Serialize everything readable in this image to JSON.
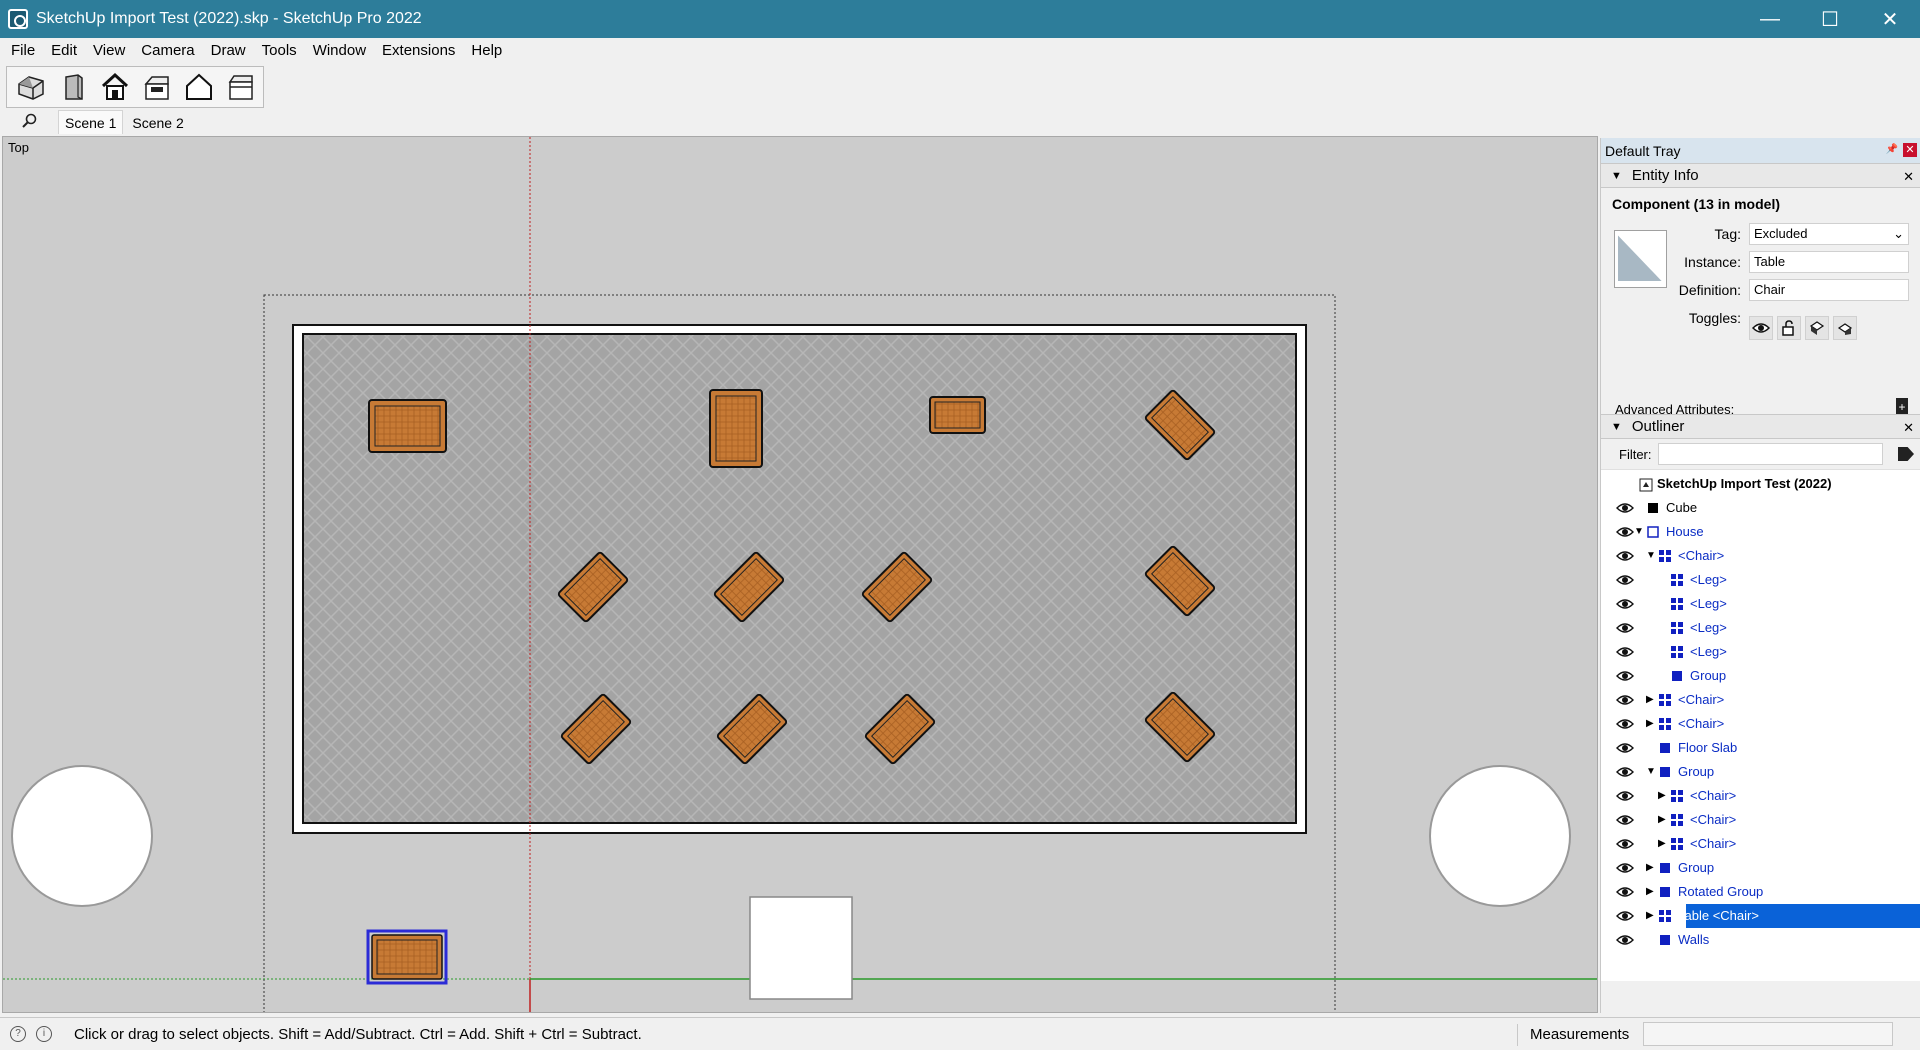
{
  "window": {
    "title": "SketchUp Import Test (2022).skp - SketchUp Pro 2022",
    "minimize": "—",
    "maximize": "☐",
    "close": "✕"
  },
  "menu": [
    "File",
    "Edit",
    "View",
    "Camera",
    "Draw",
    "Tools",
    "Window",
    "Extensions",
    "Help"
  ],
  "toolbar": {
    "tools": [
      "iso-view-icon",
      "front-view-icon",
      "top-view-icon",
      "back-view-icon",
      "left-view-icon",
      "right-view-icon"
    ]
  },
  "scenes": [
    "Scene 1",
    "Scene 2"
  ],
  "viewport": {
    "label": "Top"
  },
  "tray": {
    "title": "Default Tray",
    "entity_info": {
      "header": "Entity Info",
      "title": "Component (13 in model)",
      "tag_label": "Tag:",
      "tag_value": "Excluded",
      "instance_label": "Instance:",
      "instance_value": "Table",
      "definition_label": "Definition:",
      "definition_value": "Chair",
      "toggles_label": "Toggles:",
      "advanced_label": "Advanced Attributes:"
    },
    "outliner": {
      "header": "Outliner",
      "filter_label": "Filter:",
      "filter_value": "",
      "root": "SketchUp Import Test (2022)",
      "items": [
        {
          "label": "Cube",
          "depth": 0,
          "arrow": "",
          "icon": "group-solid",
          "style": "black"
        },
        {
          "label": "House",
          "depth": 0,
          "arrow": "▼",
          "icon": "group-outline",
          "style": "blue"
        },
        {
          "label": "<Chair>",
          "depth": 1,
          "arrow": "▼",
          "icon": "component",
          "style": "blue"
        },
        {
          "label": "<Leg>",
          "depth": 2,
          "arrow": "",
          "icon": "component",
          "style": "blue"
        },
        {
          "label": "<Leg>",
          "depth": 2,
          "arrow": "",
          "icon": "component",
          "style": "blue"
        },
        {
          "label": "<Leg>",
          "depth": 2,
          "arrow": "",
          "icon": "component",
          "style": "blue"
        },
        {
          "label": "<Leg>",
          "depth": 2,
          "arrow": "",
          "icon": "component",
          "style": "blue"
        },
        {
          "label": "Group",
          "depth": 2,
          "arrow": "",
          "icon": "group-solid",
          "style": "blue"
        },
        {
          "label": "<Chair>",
          "depth": 1,
          "arrow": "▶",
          "icon": "component",
          "style": "blue"
        },
        {
          "label": "<Chair>",
          "depth": 1,
          "arrow": "▶",
          "icon": "component",
          "style": "blue"
        },
        {
          "label": "Floor Slab",
          "depth": 1,
          "arrow": "",
          "icon": "group-solid",
          "style": "blue"
        },
        {
          "label": "Group",
          "depth": 1,
          "arrow": "▼",
          "icon": "group-solid",
          "style": "blue"
        },
        {
          "label": "<Chair>",
          "depth": 2,
          "arrow": "▶",
          "icon": "component",
          "style": "blue"
        },
        {
          "label": "<Chair>",
          "depth": 2,
          "arrow": "▶",
          "icon": "component",
          "style": "blue"
        },
        {
          "label": "<Chair>",
          "depth": 2,
          "arrow": "▶",
          "icon": "component",
          "style": "blue"
        },
        {
          "label": "Group",
          "depth": 1,
          "arrow": "▶",
          "icon": "group-solid",
          "style": "blue"
        },
        {
          "label": "Rotated Group",
          "depth": 1,
          "arrow": "▶",
          "icon": "group-solid",
          "style": "blue"
        },
        {
          "label": "Table <Chair>",
          "depth": 1,
          "arrow": "▶",
          "icon": "component",
          "style": "selected"
        },
        {
          "label": "Walls",
          "depth": 1,
          "arrow": "",
          "icon": "group-solid",
          "style": "blue"
        }
      ]
    }
  },
  "status": {
    "text": "Click or drag to select objects. Shift = Add/Subtract. Ctrl = Add. Shift + Ctrl = Subtract.",
    "measurements_label": "Measurements",
    "measurements_value": ""
  },
  "colors": {
    "titlebar": "#2d7d9a",
    "selection": "#0a62d8",
    "outliner_text": "#0a2cc4",
    "wood": "#c77a35",
    "floor": "#a8a8a8"
  }
}
